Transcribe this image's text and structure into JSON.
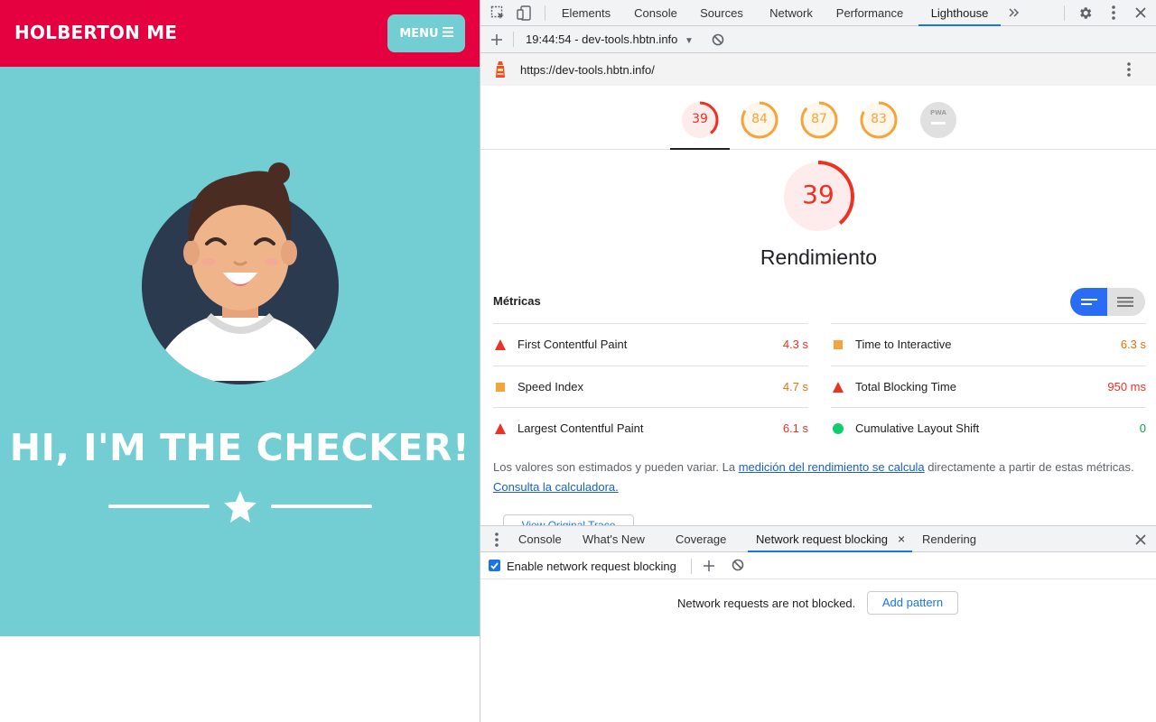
{
  "site": {
    "brand": "HOLBERTON ME",
    "menu_label": "MENU",
    "hero_title": "HI, I'M THE CHECKER!",
    "colors": {
      "header": "#e5003f",
      "hero": "#72ced3"
    }
  },
  "devtools": {
    "tabs": [
      {
        "label": "Elements"
      },
      {
        "label": "Console"
      },
      {
        "label": "Sources"
      },
      {
        "label": "Network"
      },
      {
        "label": "Performance"
      },
      {
        "label": "Lighthouse",
        "active": true
      }
    ],
    "report_select": "19:44:54 - dev-tools.hbtn.info",
    "url": "https://dev-tools.hbtn.info/",
    "category_scores": [
      {
        "score": "39",
        "status": "fail"
      },
      {
        "score": "84",
        "status": "average"
      },
      {
        "score": "87",
        "status": "average"
      },
      {
        "score": "83",
        "status": "average"
      },
      {
        "score": "PWA",
        "status": "na"
      }
    ],
    "main_score": "39",
    "category_title": "Rendimiento",
    "metrics_label": "Métricas",
    "metrics_left": [
      {
        "marker": "triangle",
        "name": "First Contentful Paint",
        "value": "4.3 s",
        "color": "#eb3223"
      },
      {
        "marker": "square",
        "name": "Speed Index",
        "value": "4.7 s",
        "color": "#e8710a"
      },
      {
        "marker": "triangle",
        "name": "Largest Contentful Paint",
        "value": "6.1 s",
        "color": "#eb3223"
      }
    ],
    "metrics_right": [
      {
        "marker": "square",
        "name": "Time to Interactive",
        "value": "6.3 s",
        "color": "#e8710a"
      },
      {
        "marker": "triangle",
        "name": "Total Blocking Time",
        "value": "950 ms",
        "color": "#eb3223"
      },
      {
        "marker": "circle",
        "name": "Cumulative Layout Shift",
        "value": "0",
        "color": "#0c9e4c"
      }
    ],
    "note": {
      "text_1": "Los valores son estimados y pueden variar. La ",
      "link_1": "medición del rendimiento se calcula",
      "text_2": " directamente a partir de estas métricas. ",
      "link_2": "Consulta la calculadora."
    },
    "view_trace_button": "View Original Trace",
    "drawer": {
      "tabs": [
        {
          "label": "Console"
        },
        {
          "label": "What's New"
        },
        {
          "label": "Coverage"
        },
        {
          "label": "Network request blocking",
          "active": true
        },
        {
          "label": "Rendering"
        }
      ],
      "enable_label": "Enable network request blocking",
      "enable_checked": true,
      "empty_message": "Network requests are not blocked.",
      "add_pattern_button": "Add pattern"
    },
    "status_colors": {
      "fail": "#eb3223",
      "average": "#f5a43a",
      "pass": "#0c9e4c"
    }
  }
}
